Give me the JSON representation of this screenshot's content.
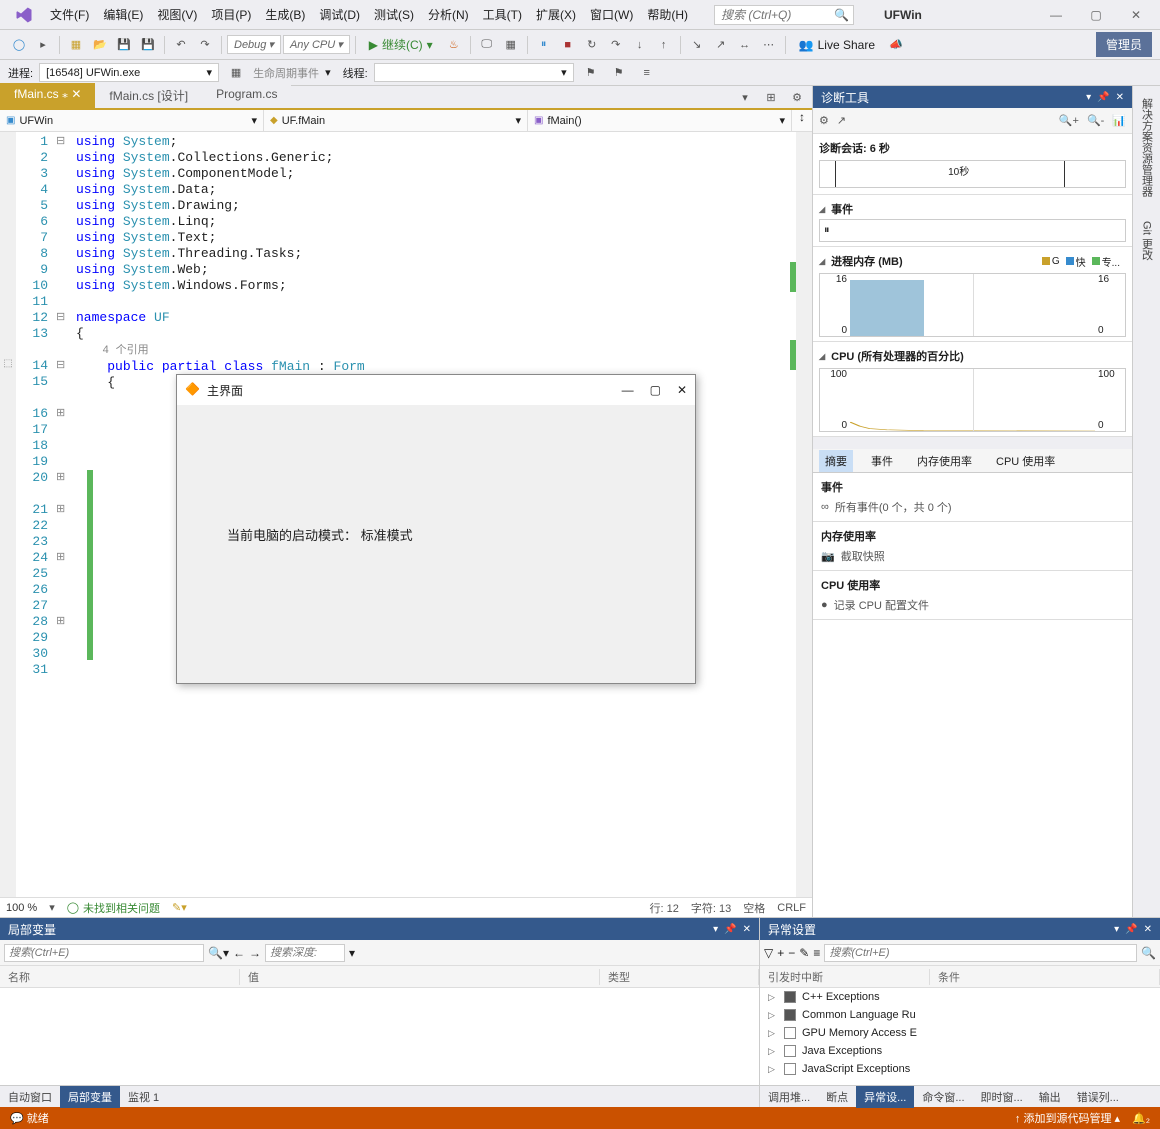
{
  "app": {
    "name": "UFWin"
  },
  "menu": [
    "文件(F)",
    "编辑(E)",
    "视图(V)",
    "项目(P)",
    "生成(B)",
    "调试(D)",
    "测试(S)",
    "分析(N)",
    "工具(T)",
    "扩展(X)",
    "窗口(W)",
    "帮助(H)"
  ],
  "search": {
    "placeholder": "搜索 (Ctrl+Q)"
  },
  "admin_label": "管理员",
  "liveshare_label": "Live Share",
  "toolbar": {
    "config": "Debug",
    "platform": "Any CPU",
    "continue": "继续(C)"
  },
  "process_bar": {
    "process_label": "进程:",
    "process_value": "[16548] UFWin.exe",
    "lifecycle": "生命周期事件",
    "thread_label": "线程:"
  },
  "tabs": [
    "fMain.cs",
    "fMain.cs [设计]",
    "Program.cs"
  ],
  "nav": {
    "left": "UFWin",
    "mid": "UF.fMain",
    "right": "fMain()"
  },
  "code": {
    "lines": [
      {
        "n": 1,
        "t": "using System;",
        "fold": "⊟"
      },
      {
        "n": 2,
        "t": "using System.Collections.Generic;"
      },
      {
        "n": 3,
        "t": "using System.ComponentModel;"
      },
      {
        "n": 4,
        "t": "using System.Data;"
      },
      {
        "n": 5,
        "t": "using System.Drawing;"
      },
      {
        "n": 6,
        "t": "using System.Linq;"
      },
      {
        "n": 7,
        "t": "using System.Text;"
      },
      {
        "n": 8,
        "t": "using System.Threading.Tasks;"
      },
      {
        "n": 9,
        "t": "using System.Web;"
      },
      {
        "n": 10,
        "t": "using System.Windows.Forms;"
      },
      {
        "n": 11,
        "t": ""
      },
      {
        "n": 12,
        "t": "namespace UF",
        "fold": "⊟"
      },
      {
        "n": 13,
        "t": "{"
      },
      {
        "n": "",
        "t": "    4 个引用",
        "ref": true
      },
      {
        "n": 14,
        "t": "    public partial class fMain : Form",
        "fold": "⊟"
      },
      {
        "n": 15,
        "t": "    {"
      },
      {
        "n": "",
        "t": ""
      },
      {
        "n": 16,
        "t": "",
        "fold": "⊞"
      },
      {
        "n": 17,
        "t": ""
      },
      {
        "n": 18,
        "t": ""
      },
      {
        "n": 19,
        "t": ""
      },
      {
        "n": 20,
        "t": "",
        "fold": "⊞"
      },
      {
        "n": "",
        "t": ""
      },
      {
        "n": 21,
        "t": "",
        "fold": "⊞"
      },
      {
        "n": 22,
        "t": ""
      },
      {
        "n": 23,
        "t": ""
      },
      {
        "n": 24,
        "t": "",
        "fold": "⊞"
      },
      {
        "n": 25,
        "t": ""
      },
      {
        "n": 26,
        "t": ""
      },
      {
        "n": 27,
        "t": ""
      },
      {
        "n": 28,
        "t": "",
        "fold": "⊞"
      },
      {
        "n": 29,
        "t": ""
      },
      {
        "n": 30,
        "t": ""
      },
      {
        "n": 31,
        "t": ""
      }
    ]
  },
  "dialog": {
    "title": "主界面",
    "body": "当前电脑的启动模式： 标准模式"
  },
  "editor_status": {
    "zoom": "100 %",
    "issues": "未找到相关问题",
    "line": "行: 12",
    "col": "字符: 13",
    "spaces": "空格",
    "eol": "CRLF"
  },
  "diag": {
    "title": "诊断工具",
    "session": "诊断会话: 6 秒",
    "timeline_tick": "10秒",
    "events_label": "事件",
    "mem_label": "进程内存 (MB)",
    "mem_legend": [
      {
        "c": "#c9a12b",
        "t": "G"
      },
      {
        "c": "#368bce",
        "t": "快"
      },
      {
        "c": "#5bb75b",
        "t": "专..."
      }
    ],
    "cpu_label": "CPU (所有处理器的百分比)",
    "tabs": [
      "摘要",
      "事件",
      "内存使用率",
      "CPU 使用率"
    ],
    "info": {
      "events_title": "事件",
      "events_text": "所有事件(0 个，共 0 个)",
      "mem_title": "内存使用率",
      "mem_text": "截取快照",
      "cpu_title": "CPU 使用率",
      "cpu_text": "记录 CPU 配置文件"
    }
  },
  "chart_data": [
    {
      "type": "area",
      "title": "进程内存 (MB)",
      "x": [
        0,
        2,
        6
      ],
      "values": [
        0,
        14,
        14
      ],
      "ylim": [
        0,
        16
      ],
      "ylabel": "MB"
    },
    {
      "type": "line",
      "title": "CPU (所有处理器的百分比)",
      "x": [
        0,
        1,
        2,
        3,
        4,
        5,
        6
      ],
      "values": [
        20,
        8,
        4,
        2,
        1,
        0,
        0
      ],
      "ylim": [
        0,
        100
      ],
      "ylabel": "%"
    }
  ],
  "locals": {
    "title": "局部变量",
    "search_ph": "搜索(Ctrl+E)",
    "depth_ph": "搜索深度:",
    "cols": [
      "名称",
      "值",
      "类型"
    ]
  },
  "exceptions": {
    "title": "异常设置",
    "search_ph": "搜索(Ctrl+E)",
    "cols": [
      "引发时中断",
      "条件"
    ],
    "items": [
      {
        "name": "C++ Exceptions",
        "state": "part"
      },
      {
        "name": "Common Language Ru",
        "state": "part"
      },
      {
        "name": "GPU Memory Access E",
        "state": "off"
      },
      {
        "name": "Java Exceptions",
        "state": "off"
      },
      {
        "name": "JavaScript Exceptions",
        "state": "off"
      }
    ]
  },
  "bottom_tabs_left": [
    "自动窗口",
    "局部变量",
    "监视 1"
  ],
  "bottom_tabs_right": [
    "调用堆...",
    "断点",
    "异常设...",
    "命令窗...",
    "即时窗...",
    "输出",
    "错误列..."
  ],
  "sidetabs": [
    "解决方案资源管理器",
    "Git 更改"
  ],
  "statusbar": {
    "ready": "就绪",
    "scm": "添加到源代码管理"
  }
}
